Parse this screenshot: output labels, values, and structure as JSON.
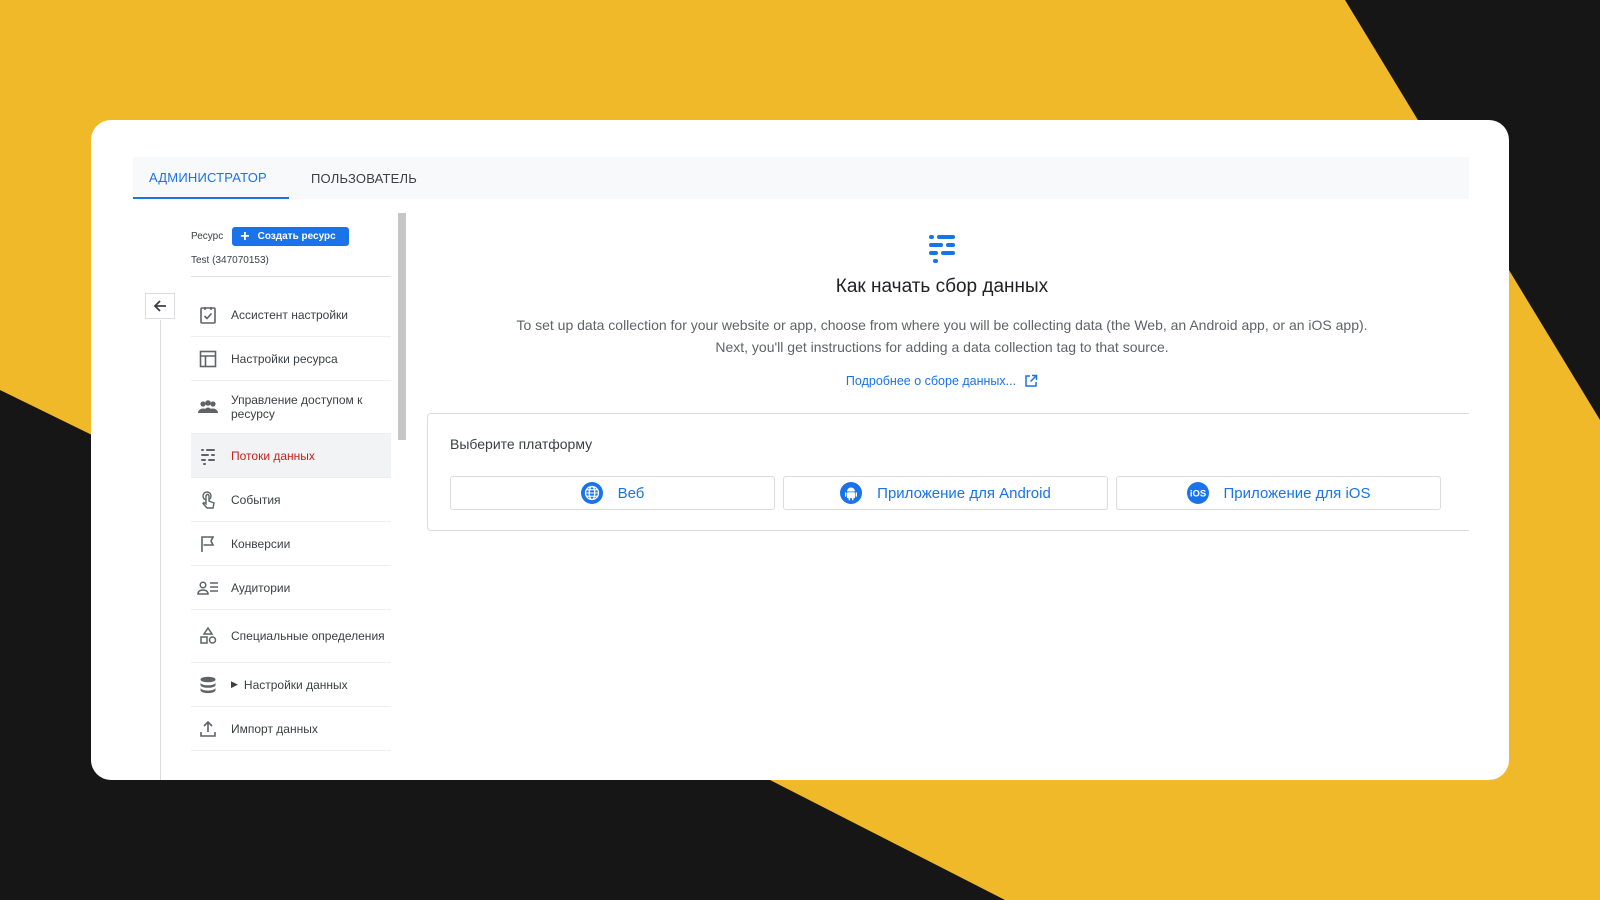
{
  "colors": {
    "accent": "#1a73e8",
    "active_item": "#c5221f",
    "background_yellow": "#f0b92a",
    "background_dark": "#161616"
  },
  "tabs": [
    {
      "label": "АДМИНИСТРАТОР",
      "active": true
    },
    {
      "label": "ПОЛЬЗОВАТЕЛЬ",
      "active": false
    }
  ],
  "sidebar": {
    "resource_label": "Ресурс",
    "create_button": "Создать ресурс",
    "resource_name": "Test (347070153)",
    "back_icon": "arrow-left-icon",
    "items": [
      {
        "label": "Ассистент настройки",
        "icon": "checklist-icon"
      },
      {
        "label": "Настройки ресурса",
        "icon": "layout-icon"
      },
      {
        "label": "Управление доступом к ресурсу",
        "icon": "people-icon"
      },
      {
        "label": "Потоки данных",
        "icon": "streams-icon",
        "active": true
      },
      {
        "label": "События",
        "icon": "touch-icon"
      },
      {
        "label": "Конверсии",
        "icon": "flag-icon"
      },
      {
        "label": "Аудитории",
        "icon": "audience-icon"
      },
      {
        "label": "Специальные определения",
        "icon": "shapes-icon"
      },
      {
        "label": "Настройки данных",
        "icon": "database-icon",
        "expandable": true
      },
      {
        "label": "Импорт данных",
        "icon": "upload-icon"
      }
    ]
  },
  "main": {
    "title": "Как начать сбор данных",
    "description_line1": "To set up data collection for your website or app, choose from where you will be collecting data (the Web, an Android app, or an iOS app).",
    "description_line2": "Next, you'll get instructions for adding a data collection tag to that source.",
    "learn_more": "Подробнее о сборе данных...",
    "platform_title": "Выберите платформу",
    "platforms": [
      {
        "label": "Веб",
        "icon": "globe-icon"
      },
      {
        "label": "Приложение для Android",
        "icon": "android-icon"
      },
      {
        "label": "Приложение для iOS",
        "icon": "ios-icon"
      }
    ]
  }
}
